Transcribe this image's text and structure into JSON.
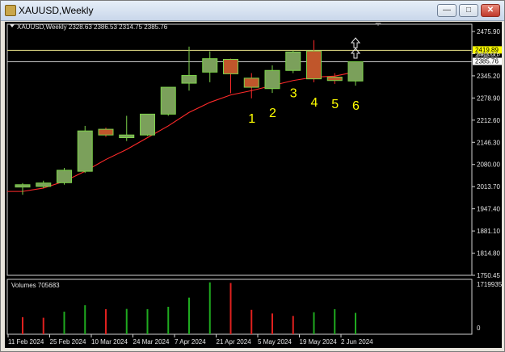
{
  "window": {
    "title": "XAUUSD,Weekly",
    "minimize": "—",
    "maximize": "□",
    "close": "✕"
  },
  "chart": {
    "header": "XAUUSD,Weekly  2328.63 2386.53 2314.75 2385.76",
    "volume_label": "Volumes 705683",
    "colors": {
      "background": "#000000",
      "bull_fill": "#7ba05b",
      "bear_fill": "#c0562b",
      "candle_outline": "#7dd34a",
      "ma_line": "#ff2a2a",
      "hline": "#c8c8c8",
      "volume_up": "#1faa1f",
      "volume_down": "#e0201e",
      "marker_text": "#ffff00"
    },
    "price_ticks": [
      "2475.90",
      "2410.75",
      "2345.20",
      "2278.90",
      "2212.60",
      "2146.30",
      "2080.00",
      "2013.70",
      "1947.40",
      "1881.10",
      "1814.80",
      "1750.45"
    ],
    "price_tags": {
      "yellow_line": "2419.89",
      "current": "2385.76",
      "partial": "2411.90"
    },
    "volume_ticks": {
      "top": "1719935",
      "bottom": "0"
    },
    "date_ticks": [
      "11 Feb 2024",
      "25 Feb 2024",
      "10 Mar 2024",
      "24 Mar 2024",
      "7 Apr 2024",
      "21 Apr 2024",
      "5 May 2024",
      "19 May 2024",
      "2 Jun 2024"
    ],
    "markers": [
      "1",
      "2",
      "3",
      "4",
      "5",
      "6"
    ],
    "arrows": [
      "up-arrow-icon",
      "up-arrow-icon"
    ]
  },
  "chart_data": {
    "type": "candlestick",
    "symbol": "XAUUSD",
    "timeframe": "Weekly",
    "ylim": [
      1750.45,
      2475.9
    ],
    "candles": [
      {
        "o": 2013.0,
        "h": 2025.0,
        "l": 1990.0,
        "c": 2020.0
      },
      {
        "o": 2015.0,
        "h": 2032.0,
        "l": 2010.0,
        "c": 2025.0
      },
      {
        "o": 2026.0,
        "h": 2070.0,
        "l": 2020.0,
        "c": 2063.0
      },
      {
        "o": 2060.0,
        "h": 2195.0,
        "l": 2055.0,
        "c": 2180.0
      },
      {
        "o": 2185.0,
        "h": 2190.0,
        "l": 2162.0,
        "c": 2168.0
      },
      {
        "o": 2160.0,
        "h": 2225.0,
        "l": 2150.0,
        "c": 2168.0
      },
      {
        "o": 2168.0,
        "h": 2225.0,
        "l": 2165.0,
        "c": 2230.0
      },
      {
        "o": 2230.0,
        "h": 2305.0,
        "l": 2225.0,
        "c": 2310.0
      },
      {
        "o": 2322.0,
        "h": 2431.0,
        "l": 2300.0,
        "c": 2345.0
      },
      {
        "o": 2355.0,
        "h": 2417.0,
        "l": 2325.0,
        "c": 2395.0
      },
      {
        "o": 2393.0,
        "h": 2395.0,
        "l": 2292.0,
        "c": 2350.0
      },
      {
        "o": 2337.0,
        "h": 2352.0,
        "l": 2277.0,
        "c": 2310.0
      },
      {
        "o": 2306.0,
        "h": 2375.0,
        "l": 2293.0,
        "c": 2360.0
      },
      {
        "o": 2360.0,
        "h": 2420.0,
        "l": 2352.0,
        "c": 2415.0
      },
      {
        "o": 2418.0,
        "h": 2450.0,
        "l": 2325.0,
        "c": 2335.0
      },
      {
        "o": 2340.0,
        "h": 2352.0,
        "l": 2320.0,
        "c": 2330.0
      },
      {
        "o": 2328.63,
        "h": 2386.53,
        "l": 2314.75,
        "c": 2385.76
      }
    ],
    "moving_average": [
      2000,
      2010,
      2030,
      2060,
      2095,
      2125,
      2160,
      2195,
      2235,
      2265,
      2287,
      2300,
      2315,
      2330,
      2340,
      2343,
      2356
    ],
    "volumes": [
      {
        "v": 560000,
        "dir": "down"
      },
      {
        "v": 540000,
        "dir": "down"
      },
      {
        "v": 740000,
        "dir": "up"
      },
      {
        "v": 950000,
        "dir": "up"
      },
      {
        "v": 820000,
        "dir": "down"
      },
      {
        "v": 830000,
        "dir": "up"
      },
      {
        "v": 820000,
        "dir": "up"
      },
      {
        "v": 900000,
        "dir": "up"
      },
      {
        "v": 1200000,
        "dir": "up"
      },
      {
        "v": 1700000,
        "dir": "up"
      },
      {
        "v": 1680000,
        "dir": "down"
      },
      {
        "v": 800000,
        "dir": "down"
      },
      {
        "v": 680000,
        "dir": "down"
      },
      {
        "v": 600000,
        "dir": "down"
      },
      {
        "v": 720000,
        "dir": "up"
      },
      {
        "v": 820000,
        "dir": "up"
      },
      {
        "v": 700000,
        "dir": "up"
      }
    ],
    "vol_max": 1719935,
    "marker_candles": [
      11,
      12,
      13,
      14,
      15,
      16
    ],
    "arrow_candle": 16
  }
}
